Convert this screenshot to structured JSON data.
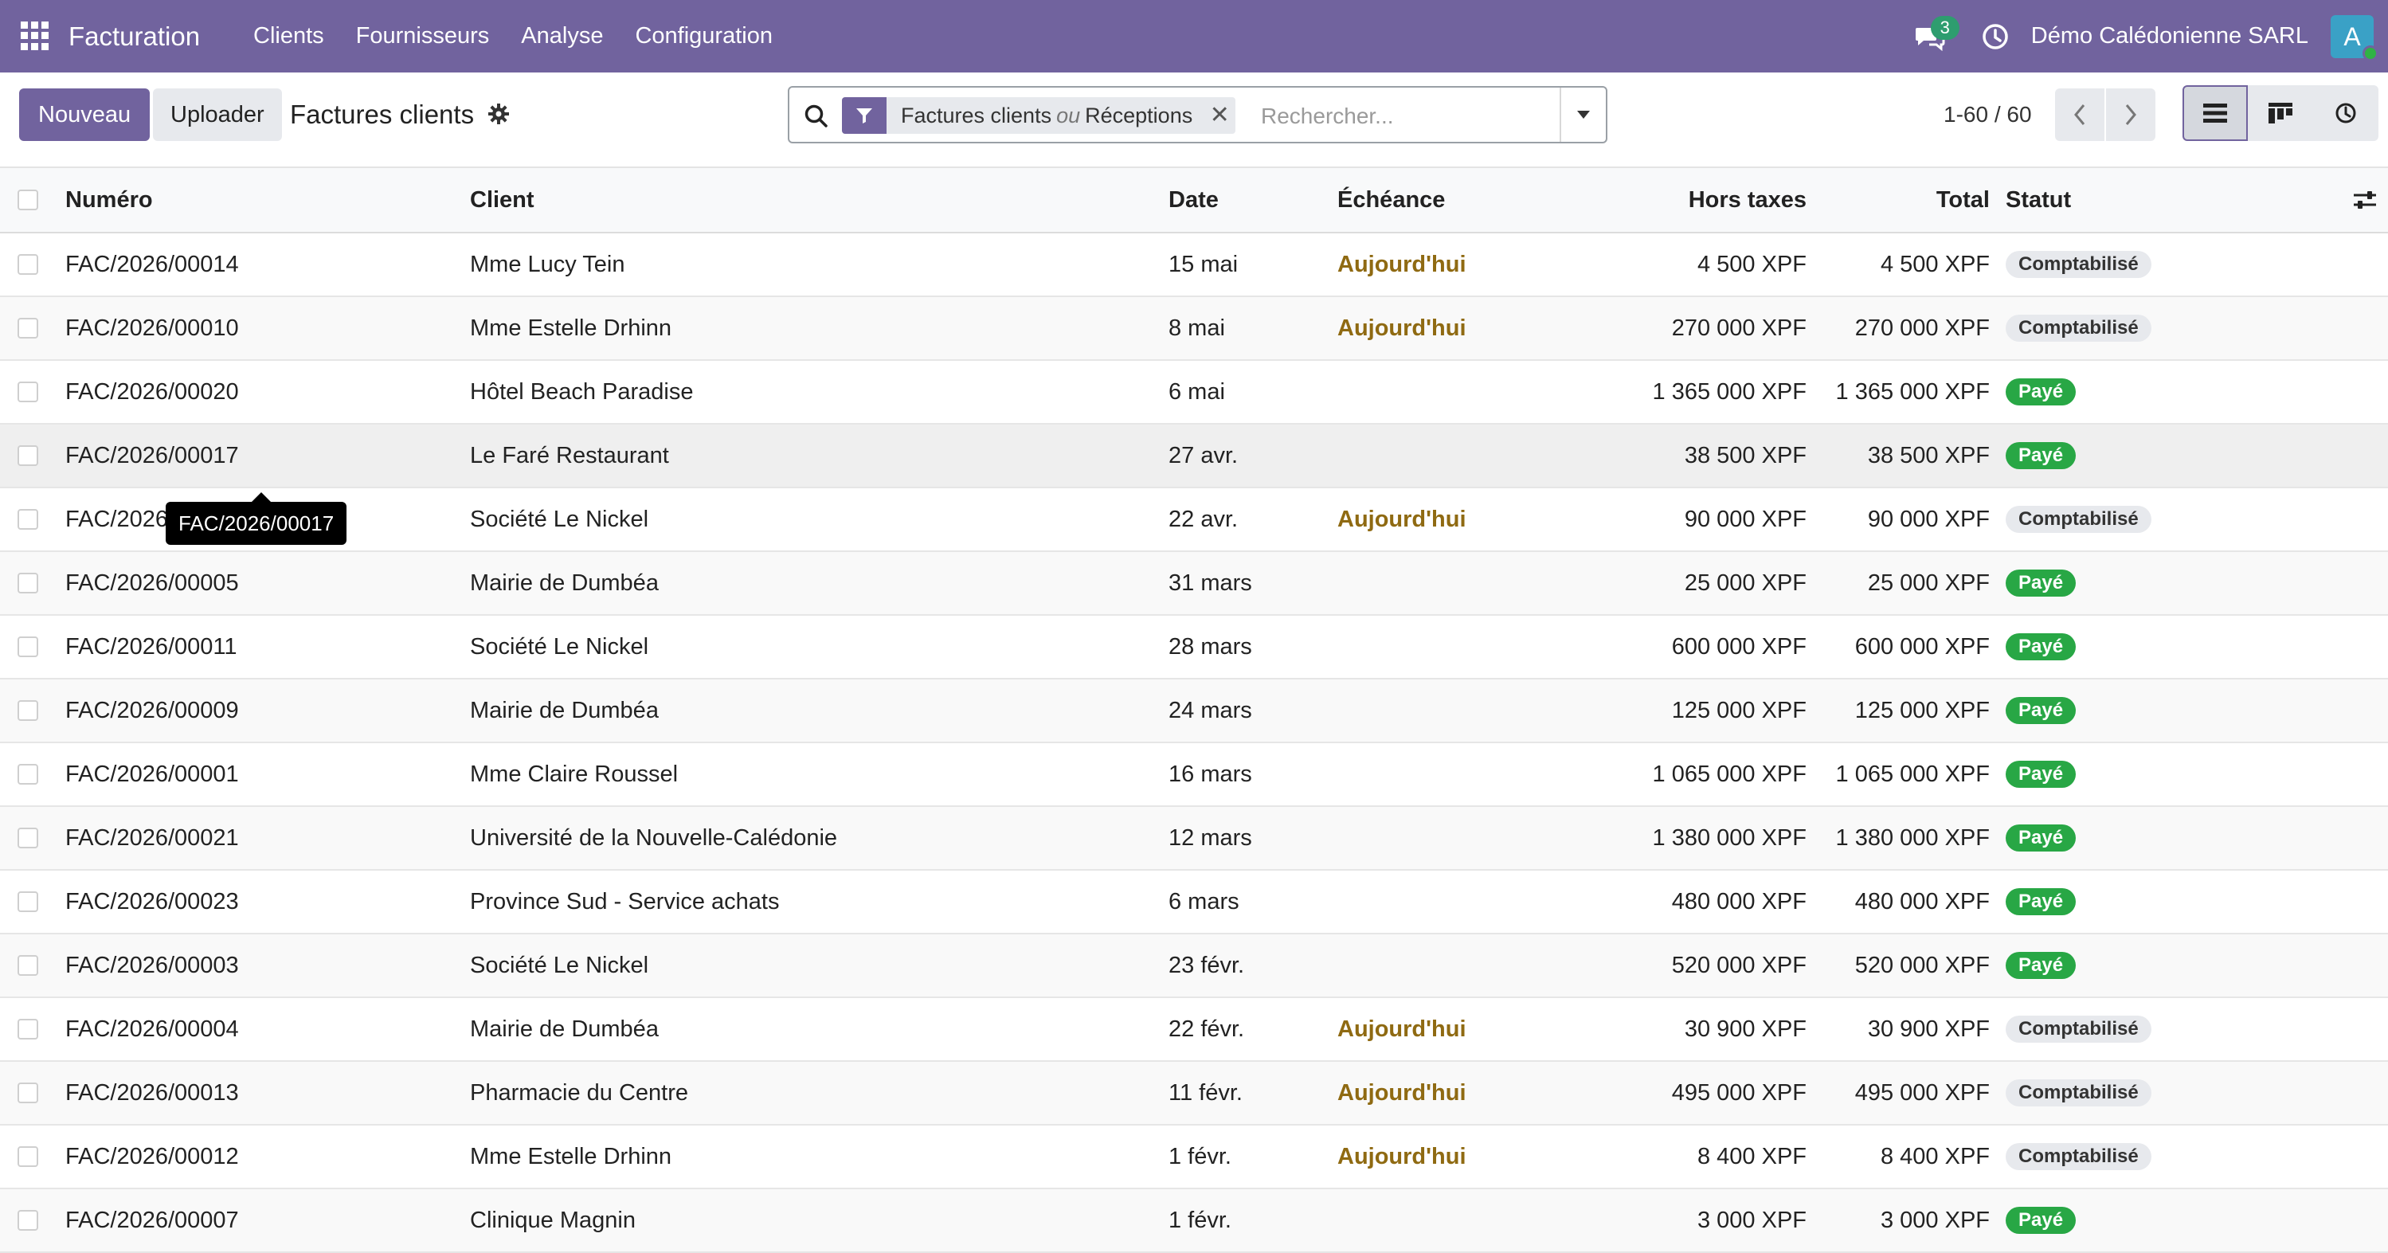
{
  "navbar": {
    "app_name": "Facturation",
    "menu": [
      "Clients",
      "Fournisseurs",
      "Analyse",
      "Configuration"
    ],
    "chat_count": "3",
    "company": "Démo Calédonienne SARL",
    "avatar_initial": "A",
    "color": "#71639e"
  },
  "control": {
    "new_label": "Nouveau",
    "upload_label": "Uploader",
    "title": "Factures clients",
    "search": {
      "facet_a": "Factures clients",
      "facet_or": "ou",
      "facet_b": "Réceptions",
      "placeholder": "Rechercher..."
    },
    "pager": "1-60 / 60"
  },
  "table": {
    "headers": {
      "number": "Numéro",
      "client": "Client",
      "date": "Date",
      "due": "Échéance",
      "untaxed": "Hors taxes",
      "total": "Total",
      "status": "Statut"
    },
    "rows": [
      {
        "number": "FAC/2026/00014",
        "client": "Mme Lucy Tein",
        "date": "15 mai",
        "due": "Aujourd'hui",
        "untaxed": "4 500 XPF",
        "total": "4 500 XPF",
        "status": "Comptabilisé",
        "kind": "compta"
      },
      {
        "number": "FAC/2026/00010",
        "client": "Mme Estelle Drhinn",
        "date": "8 mai",
        "due": "Aujourd'hui",
        "untaxed": "270 000 XPF",
        "total": "270 000 XPF",
        "status": "Comptabilisé",
        "kind": "compta"
      },
      {
        "number": "FAC/2026/00020",
        "client": "Hôtel Beach Paradise",
        "date": "6 mai",
        "due": "",
        "untaxed": "1 365 000 XPF",
        "total": "1 365 000 XPF",
        "status": "Payé",
        "kind": "paye"
      },
      {
        "number": "FAC/2026/00017",
        "client": "Le Faré Restaurant",
        "date": "27 avr.",
        "due": "",
        "untaxed": "38 500 XPF",
        "total": "38 500 XPF",
        "status": "Payé",
        "kind": "paye"
      },
      {
        "number": "FAC/2026",
        "client": "Société Le Nickel",
        "date": "22 avr.",
        "due": "Aujourd'hui",
        "untaxed": "90 000 XPF",
        "total": "90 000 XPF",
        "status": "Comptabilisé",
        "kind": "compta"
      },
      {
        "number": "FAC/2026/00005",
        "client": "Mairie de Dumbéa",
        "date": "31 mars",
        "due": "",
        "untaxed": "25 000 XPF",
        "total": "25 000 XPF",
        "status": "Payé",
        "kind": "paye"
      },
      {
        "number": "FAC/2026/00011",
        "client": "Société Le Nickel",
        "date": "28 mars",
        "due": "",
        "untaxed": "600 000 XPF",
        "total": "600 000 XPF",
        "status": "Payé",
        "kind": "paye"
      },
      {
        "number": "FAC/2026/00009",
        "client": "Mairie de Dumbéa",
        "date": "24 mars",
        "due": "",
        "untaxed": "125 000 XPF",
        "total": "125 000 XPF",
        "status": "Payé",
        "kind": "paye"
      },
      {
        "number": "FAC/2026/00001",
        "client": "Mme Claire Roussel",
        "date": "16 mars",
        "due": "",
        "untaxed": "1 065 000 XPF",
        "total": "1 065 000 XPF",
        "status": "Payé",
        "kind": "paye"
      },
      {
        "number": "FAC/2026/00021",
        "client": "Université de la Nouvelle-Calédonie",
        "date": "12 mars",
        "due": "",
        "untaxed": "1 380 000 XPF",
        "total": "1 380 000 XPF",
        "status": "Payé",
        "kind": "paye"
      },
      {
        "number": "FAC/2026/00023",
        "client": "Province Sud - Service achats",
        "date": "6 mars",
        "due": "",
        "untaxed": "480 000 XPF",
        "total": "480 000 XPF",
        "status": "Payé",
        "kind": "paye"
      },
      {
        "number": "FAC/2026/00003",
        "client": "Société Le Nickel",
        "date": "23 févr.",
        "due": "",
        "untaxed": "520 000 XPF",
        "total": "520 000 XPF",
        "status": "Payé",
        "kind": "paye"
      },
      {
        "number": "FAC/2026/00004",
        "client": "Mairie de Dumbéa",
        "date": "22 févr.",
        "due": "Aujourd'hui",
        "untaxed": "30 900 XPF",
        "total": "30 900 XPF",
        "status": "Comptabilisé",
        "kind": "compta"
      },
      {
        "number": "FAC/2026/00013",
        "client": "Pharmacie du Centre",
        "date": "11 févr.",
        "due": "Aujourd'hui",
        "untaxed": "495 000 XPF",
        "total": "495 000 XPF",
        "status": "Comptabilisé",
        "kind": "compta"
      },
      {
        "number": "FAC/2026/00012",
        "client": "Mme Estelle Drhinn",
        "date": "1 févr.",
        "due": "Aujourd'hui",
        "untaxed": "8 400 XPF",
        "total": "8 400 XPF",
        "status": "Comptabilisé",
        "kind": "compta"
      },
      {
        "number": "FAC/2026/00007",
        "client": "Clinique Magnin",
        "date": "1 févr.",
        "due": "",
        "untaxed": "3 000 XPF",
        "total": "3 000 XPF",
        "status": "Payé",
        "kind": "paye"
      }
    ]
  },
  "tooltip": "FAC/2026/00017"
}
